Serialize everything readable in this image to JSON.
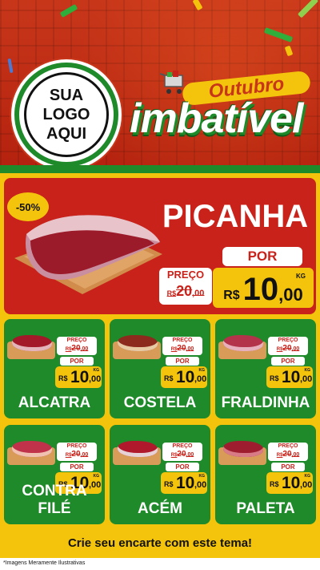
{
  "brand": {
    "logo_lines": [
      "SUA",
      "LOGO",
      "AQUI"
    ],
    "title_top": "Outubro",
    "title_main": "imbatível"
  },
  "colors": {
    "red": "#c8221a",
    "green": "#1e8a2a",
    "yellow": "#f4c40c",
    "white": "#ffffff"
  },
  "hero": {
    "discount": "-50%",
    "name": "PICANHA",
    "preco_label": "PREÇO",
    "old_price": "R$ 20,00",
    "old_prefix": "R$",
    "old_value": "20",
    "old_cents": ",00",
    "por_label": "POR",
    "currency": "R$",
    "new_value": "10",
    "new_cents": ",00",
    "unit": "KG"
  },
  "products": [
    {
      "name": "ALCATRA",
      "preco_label": "PREÇO",
      "old_prefix": "R$",
      "old_value": "20",
      "old_cents": ",00",
      "por_label": "POR",
      "currency": "R$",
      "new_value": "10",
      "new_cents": ",00",
      "unit": "KG"
    },
    {
      "name": "COSTELA",
      "preco_label": "PREÇO",
      "old_prefix": "R$",
      "old_value": "20",
      "old_cents": ",00",
      "por_label": "POR",
      "currency": "R$",
      "new_value": "10",
      "new_cents": ",00",
      "unit": "KG"
    },
    {
      "name": "FRALDINHA",
      "preco_label": "PREÇO",
      "old_prefix": "R$",
      "old_value": "20",
      "old_cents": ",00",
      "por_label": "POR",
      "currency": "R$",
      "new_value": "10",
      "new_cents": ",00",
      "unit": "KG"
    },
    {
      "name": "CONTRA FILÉ",
      "preco_label": "PREÇO",
      "old_prefix": "R$",
      "old_value": "20",
      "old_cents": ",00",
      "por_label": "POR",
      "currency": "R$",
      "new_value": "10",
      "new_cents": ",00",
      "unit": "KG"
    },
    {
      "name": "ACÉM",
      "preco_label": "PREÇO",
      "old_prefix": "R$",
      "old_value": "20",
      "old_cents": ",00",
      "por_label": "POR",
      "currency": "R$",
      "new_value": "10",
      "new_cents": ",00",
      "unit": "KG"
    },
    {
      "name": "PALETA",
      "preco_label": "PREÇO",
      "old_prefix": "R$",
      "old_value": "20",
      "old_cents": ",00",
      "por_label": "POR",
      "currency": "R$",
      "new_value": "10",
      "new_cents": ",00",
      "unit": "KG"
    }
  ],
  "footer": {
    "cta": "Crie seu encarte com este tema!",
    "disclaimer": "*Imagens Meramente Ilustrativas"
  }
}
